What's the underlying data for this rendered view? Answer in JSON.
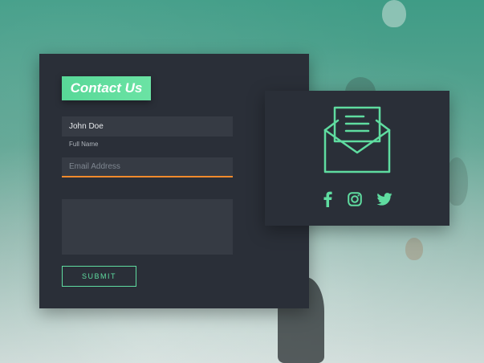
{
  "form": {
    "title": "Contact Us",
    "name_value": "John Doe",
    "name_label": "Full Name",
    "email_placeholder": "Email Address",
    "submit_label": "SUBMIT"
  },
  "info": {
    "icons": [
      "envelope-letter-icon",
      "facebook-icon",
      "instagram-icon",
      "twitter-icon"
    ]
  },
  "colors": {
    "accent": "#5fdca0",
    "card": "#2a2f38",
    "field": "#363b44",
    "focus_underline": "#f08a2c"
  }
}
